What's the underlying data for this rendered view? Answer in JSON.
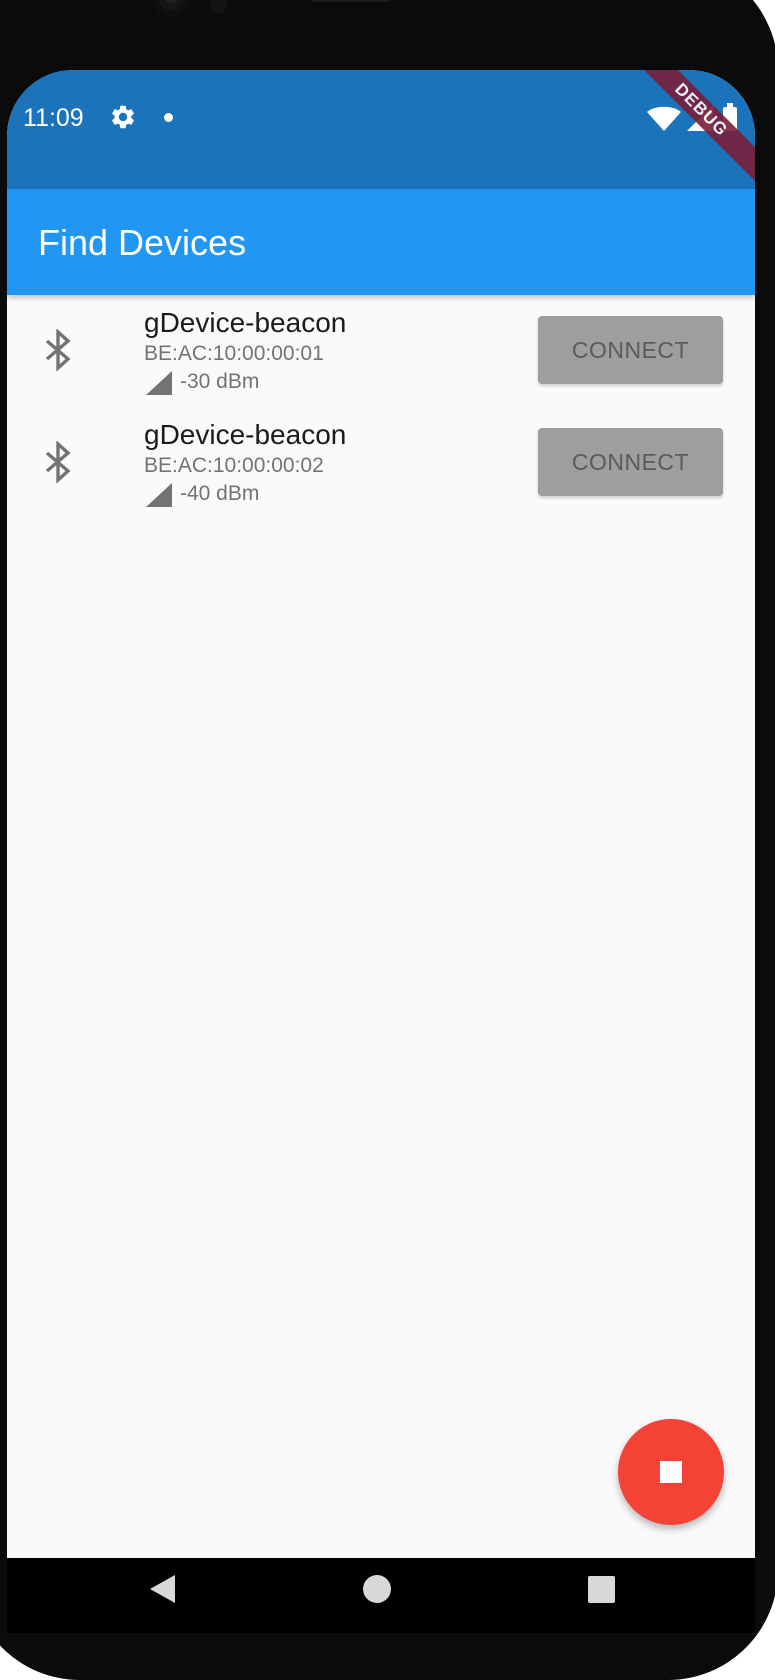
{
  "status_bar": {
    "time": "11:09",
    "left_icons": [
      "gear-icon",
      "notification-dot-icon"
    ],
    "right_icons": [
      "wifi-icon",
      "cell-signal-icon",
      "battery-icon"
    ],
    "debug_banner": "DEBUG",
    "color": "#1a73bb"
  },
  "app_bar": {
    "title": "Find Devices",
    "color": "#2196f3"
  },
  "devices": [
    {
      "name": "gDevice-beacon",
      "address": "BE:AC:10:00:00:01",
      "rssi": "-30 dBm",
      "icon": "bluetooth-icon",
      "button_label": "CONNECT"
    },
    {
      "name": "gDevice-beacon",
      "address": "BE:AC:10:00:00:02",
      "rssi": "-40 dBm",
      "icon": "bluetooth-icon",
      "button_label": "CONNECT"
    }
  ],
  "fab": {
    "icon": "stop-icon",
    "color": "#f44336"
  },
  "nav_bar": {
    "buttons": [
      "back-icon",
      "home-icon",
      "recents-icon"
    ]
  }
}
